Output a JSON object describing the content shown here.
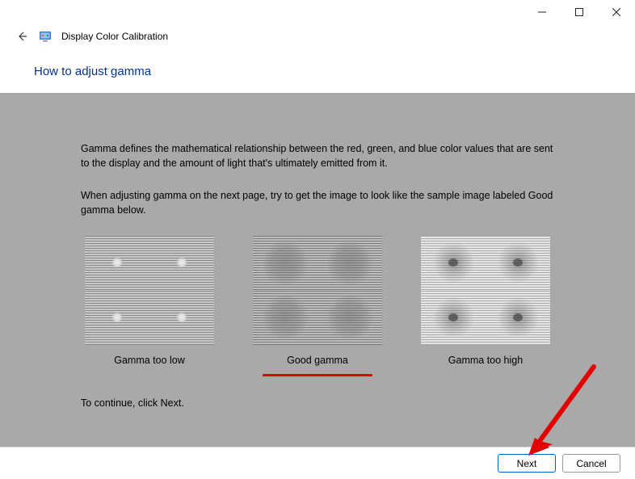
{
  "window": {
    "app_title": "Display Color Calibration"
  },
  "page": {
    "title": "How to adjust gamma",
    "paragraph1": "Gamma defines the mathematical relationship between the red, green, and blue color values that are sent to the display and the amount of light that's ultimately emitted from it.",
    "paragraph2": "When adjusting gamma on the next page, try to get the image to look like the sample image labeled Good gamma below.",
    "samples": {
      "low": "Gamma too low",
      "good": "Good gamma",
      "high": "Gamma too high"
    },
    "continue_text": "To continue, click Next."
  },
  "footer": {
    "next": "Next",
    "cancel": "Cancel"
  }
}
